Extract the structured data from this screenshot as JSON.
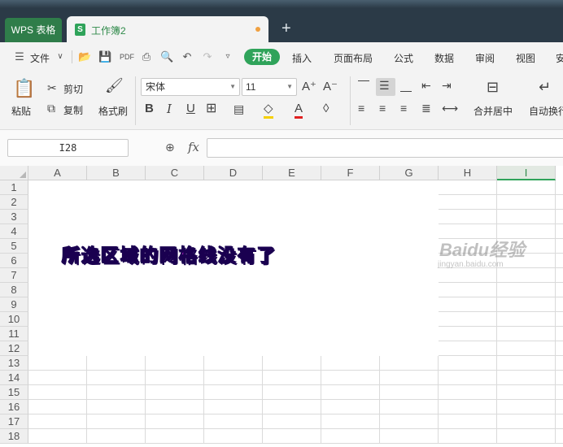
{
  "titlebar": {
    "app_tab": "WPS 表格",
    "doc_tab": "工作簿2",
    "new_tab": "+"
  },
  "menu": {
    "file": "文件",
    "items": [
      "开始",
      "插入",
      "页面布局",
      "公式",
      "数据",
      "审阅",
      "视图",
      "安"
    ]
  },
  "ribbon": {
    "paste": "粘贴",
    "cut": "剪切",
    "copy": "复制",
    "format_painter": "格式刷",
    "font_name": "宋体",
    "font_size": "11",
    "bold": "B",
    "italic": "I",
    "underline": "U",
    "merge_center": "合并居中",
    "wrap_text": "自动换行"
  },
  "formula_bar": {
    "name_box": "I28",
    "fx": "fx",
    "content": ""
  },
  "grid": {
    "columns": [
      "A",
      "B",
      "C",
      "D",
      "E",
      "F",
      "G",
      "H",
      "I"
    ],
    "selected_column": "I",
    "rows": [
      "1",
      "2",
      "3",
      "4",
      "5",
      "6",
      "7",
      "8",
      "9",
      "10",
      "11",
      "12",
      "13",
      "14",
      "15",
      "16",
      "17",
      "18"
    ]
  },
  "caption": "所选区域的网格线没有了",
  "watermark": {
    "brand": "Baidu经验",
    "url": "jingyan.baidu.com"
  },
  "colors": {
    "accent": "#2fa35a",
    "titlebar": "#2b3a47",
    "caption": "#ff33ff"
  }
}
